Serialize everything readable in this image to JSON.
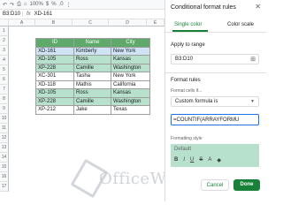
{
  "toolbar": {
    "undo": "↶",
    "redo": "↷",
    "print": "⎙",
    "paint": "⌂",
    "zoom": "100%",
    "currency": "$",
    "percent": "%",
    "decimal": ".0",
    "more": "⋮"
  },
  "formula_bar": {
    "cell_ref": "B3:D10",
    "fx": "fx",
    "value": "XD-161"
  },
  "sheet": {
    "columns": [
      "A",
      "B",
      "C",
      "D",
      "E"
    ],
    "rows": [
      "1",
      "2",
      "3",
      "4",
      "5",
      "6",
      "7",
      "8",
      "9",
      "10",
      "11",
      "12",
      "13",
      "14",
      "15",
      "16",
      "17"
    ],
    "table_headers": [
      "ID",
      "Name",
      "City"
    ],
    "table_rows": [
      [
        "XD-161",
        "Kimberly",
        "New York"
      ],
      [
        "XD-105",
        "Ross",
        "Kansas"
      ],
      [
        "XP-228",
        "Camille",
        "Washington"
      ],
      [
        "XC-301",
        "Tasha",
        "New York"
      ],
      [
        "XD-118",
        "Mathis",
        "California"
      ],
      [
        "XD-105",
        "Ross",
        "Kansas"
      ],
      [
        "XP-228",
        "Camille",
        "Washington"
      ],
      [
        "XP-212",
        "Jake",
        "Texas"
      ]
    ]
  },
  "watermark": "OfficeWheel",
  "panel": {
    "title": "Conditional format rules",
    "close": "✕",
    "tabs": [
      "Single color",
      "Color scale"
    ],
    "apply_label": "Apply to range",
    "range_value": "B3:D10",
    "range_icon": "⊞",
    "rules_label": "Format rules",
    "format_cells_if": "Format cells if...",
    "condition": "Custom formula is",
    "caret": "▼",
    "formula": "=COUNTIF(ARRAYFORMU",
    "style_label": "Formatting style",
    "style_default": "Default",
    "style_icons": [
      "B",
      "I",
      "U",
      "S",
      "A",
      "◆"
    ],
    "cancel_label": "Cancel",
    "done_label": "Done"
  }
}
